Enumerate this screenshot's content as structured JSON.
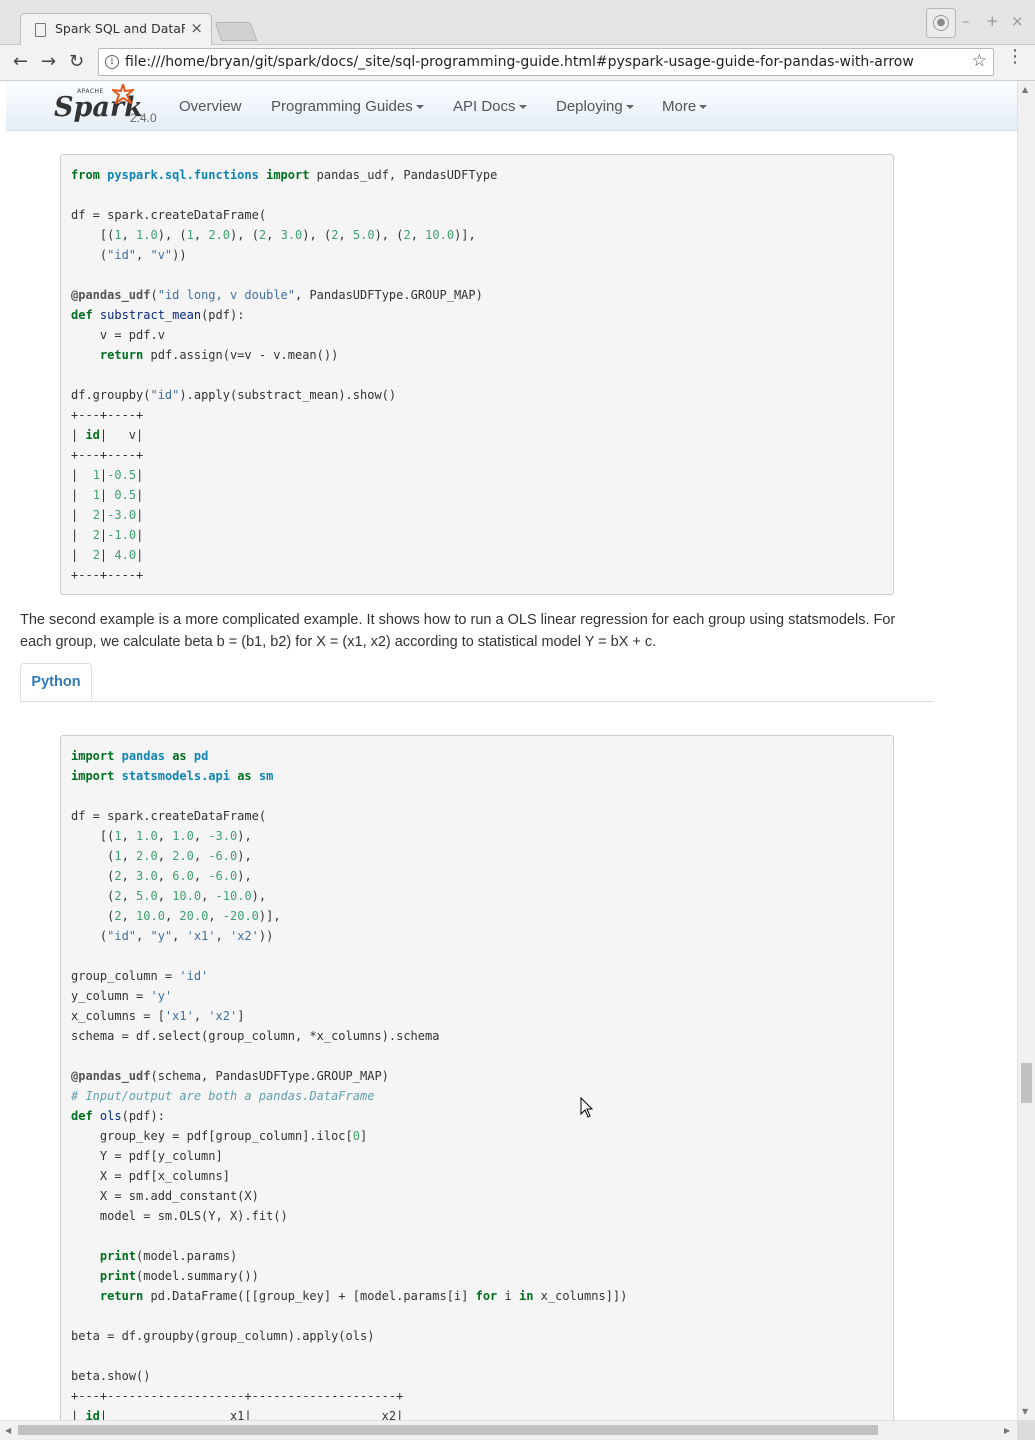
{
  "browser": {
    "tab_title": "Spark SQL and DataFrames",
    "tab_close": "×",
    "url": "file:///home/bryan/git/spark/docs/_site/sql-programming-guide.html#pyspark-usage-guide-for-pandas-with-arrow",
    "back": "←",
    "forward": "→",
    "reload": "↻",
    "bookmark": "☆",
    "info": "i",
    "menu": "⋮",
    "minimize": "–",
    "maximize": "+",
    "close": "×"
  },
  "navbar": {
    "logo_apache": "APACHE",
    "logo_word": "Spark",
    "version": "2.4.0",
    "items": [
      {
        "label": "Overview"
      },
      {
        "label": "Programming Guides"
      },
      {
        "label": "API Docs"
      },
      {
        "label": "Deploying"
      },
      {
        "label": "More"
      }
    ]
  },
  "content": {
    "paragraph": "The second example is a more complicated example. It shows how to run a OLS linear regression for each group using statsmodels. For each group, we calculate beta b = (b1, b2) for X = (x1, x2) according to statistical model Y = bX + c.",
    "tab_python": "Python",
    "code1": [
      "from pyspark.sql.functions import pandas_udf, PandasUDFType",
      "",
      "df = spark.createDataFrame(",
      "    [(1, 1.0), (1, 2.0), (2, 3.0), (2, 5.0), (2, 10.0)],",
      "    (\"id\", \"v\"))",
      "",
      "@pandas_udf(\"id long, v double\", PandasUDFType.GROUP_MAP)",
      "def substract_mean(pdf):",
      "    v = pdf.v",
      "    return pdf.assign(v=v - v.mean())",
      "",
      "df.groupby(\"id\").apply(substract_mean).show()",
      "+---+----+",
      "| id|   v|",
      "+---+----+",
      "|  1|-0.5|",
      "|  1| 0.5|",
      "|  2|-3.0|",
      "|  2|-1.0|",
      "|  2| 4.0|",
      "+---+----+"
    ],
    "code2": [
      "import pandas as pd",
      "import statsmodels.api as sm",
      "",
      "df = spark.createDataFrame(",
      "    [(1, 1.0, 1.0, -3.0),",
      "     (1, 2.0, 2.0, -6.0),",
      "     (2, 3.0, 6.0, -6.0),",
      "     (2, 5.0, 10.0, -10.0),",
      "     (2, 10.0, 20.0, -20.0)],",
      "    (\"id\", \"y\", 'x1', 'x2'))",
      "",
      "group_column = 'id'",
      "y_column = 'y'",
      "x_columns = ['x1', 'x2']",
      "schema = df.select(group_column, *x_columns).schema",
      "",
      "@pandas_udf(schema, PandasUDFType.GROUP_MAP)",
      "# Input/output are both a pandas.DataFrame",
      "def ols(pdf):",
      "    group_key = pdf[group_column].iloc[0]",
      "    Y = pdf[y_column]",
      "    X = pdf[x_columns]",
      "    X = sm.add_constant(X)",
      "    model = sm.OLS(Y, X).fit()",
      "",
      "    print(model.params)",
      "    print(model.summary())",
      "    return pd.DataFrame([[group_key] + [model.params[i] for i in x_columns]])",
      "",
      "beta = df.groupby(group_column).apply(ols)",
      "",
      "beta.show()",
      "+---+-------------------+--------------------+",
      "| id|                 x1|                  x2|"
    ]
  },
  "colors": {
    "keyword": "#007020",
    "namespace": "#0e84b5",
    "string": "#4070a0",
    "number": "#40a070",
    "comment": "#60a0b0",
    "link": "#2f7ab8"
  }
}
